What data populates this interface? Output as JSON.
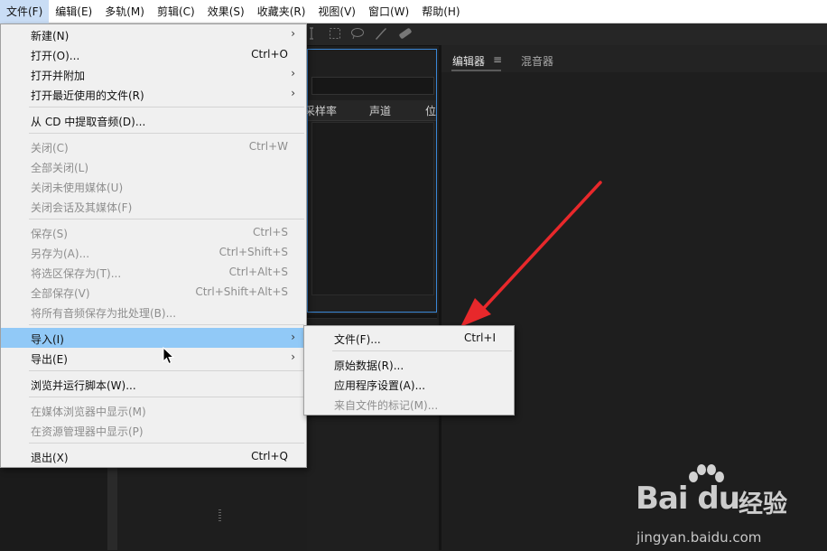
{
  "menubar": {
    "items": [
      {
        "label": "文件(F)"
      },
      {
        "label": "编辑(E)"
      },
      {
        "label": "多轨(M)"
      },
      {
        "label": "剪辑(C)"
      },
      {
        "label": "效果(S)"
      },
      {
        "label": "收藏夹(R)"
      },
      {
        "label": "视图(V)"
      },
      {
        "label": "窗口(W)"
      },
      {
        "label": "帮助(H)"
      }
    ]
  },
  "file_menu": {
    "items": [
      {
        "label": "新建(N)",
        "shortcut": "",
        "submenu": true,
        "disabled": false
      },
      {
        "label": "打开(O)...",
        "shortcut": "Ctrl+O",
        "submenu": false,
        "disabled": false
      },
      {
        "label": "打开并附加",
        "shortcut": "",
        "submenu": true,
        "disabled": false
      },
      {
        "label": "打开最近使用的文件(R)",
        "shortcut": "",
        "submenu": true,
        "disabled": false
      },
      {
        "label": "从 CD 中提取音频(D)...",
        "shortcut": "",
        "submenu": false,
        "disabled": false
      },
      {
        "label": "关闭(C)",
        "shortcut": "Ctrl+W",
        "submenu": false,
        "disabled": true
      },
      {
        "label": "全部关闭(L)",
        "shortcut": "",
        "submenu": false,
        "disabled": true
      },
      {
        "label": "关闭未使用媒体(U)",
        "shortcut": "",
        "submenu": false,
        "disabled": true
      },
      {
        "label": "关闭会话及其媒体(F)",
        "shortcut": "",
        "submenu": false,
        "disabled": true
      },
      {
        "label": "保存(S)",
        "shortcut": "Ctrl+S",
        "submenu": false,
        "disabled": true
      },
      {
        "label": "另存为(A)...",
        "shortcut": "Ctrl+Shift+S",
        "submenu": false,
        "disabled": true
      },
      {
        "label": "将选区保存为(T)...",
        "shortcut": "Ctrl+Alt+S",
        "submenu": false,
        "disabled": true
      },
      {
        "label": "全部保存(V)",
        "shortcut": "Ctrl+Shift+Alt+S",
        "submenu": false,
        "disabled": true
      },
      {
        "label": "将所有音频保存为批处理(B)...",
        "shortcut": "",
        "submenu": false,
        "disabled": true
      },
      {
        "label": "导入(I)",
        "shortcut": "",
        "submenu": true,
        "disabled": false,
        "highlighted": true
      },
      {
        "label": "导出(E)",
        "shortcut": "",
        "submenu": true,
        "disabled": false
      },
      {
        "label": "浏览并运行脚本(W)...",
        "shortcut": "",
        "submenu": false,
        "disabled": false
      },
      {
        "label": "在媒体浏览器中显示(M)",
        "shortcut": "",
        "submenu": false,
        "disabled": true
      },
      {
        "label": "在资源管理器中显示(P)",
        "shortcut": "",
        "submenu": false,
        "disabled": true
      },
      {
        "label": "退出(X)",
        "shortcut": "Ctrl+Q",
        "submenu": false,
        "disabled": false
      }
    ]
  },
  "import_submenu": {
    "items": [
      {
        "label": "文件(F)...",
        "shortcut": "Ctrl+I",
        "disabled": false
      },
      {
        "label": "原始数据(R)...",
        "shortcut": "",
        "disabled": false
      },
      {
        "label": "应用程序设置(A)...",
        "shortcut": "",
        "disabled": false
      },
      {
        "label": "来自文件的标记(M)...",
        "shortcut": "",
        "disabled": true
      }
    ]
  },
  "files_panel": {
    "columns": [
      "采样率",
      "声道",
      "位"
    ]
  },
  "right_panel": {
    "tabs": [
      {
        "label": "编辑器",
        "active": true
      },
      {
        "label": "混音器",
        "active": false
      }
    ],
    "tab_menu_glyph": "≡"
  },
  "watermark": {
    "logo": "Bai du",
    "brand_cn": "经验",
    "url": "jingyan.baidu.com"
  },
  "colors": {
    "menu_bg": "#f0f0f0",
    "menu_highlight": "#91c9f7",
    "app_bg": "#1e1e1e",
    "panel_focus_border": "#3a87d6",
    "arrow_red": "#e8282b"
  }
}
